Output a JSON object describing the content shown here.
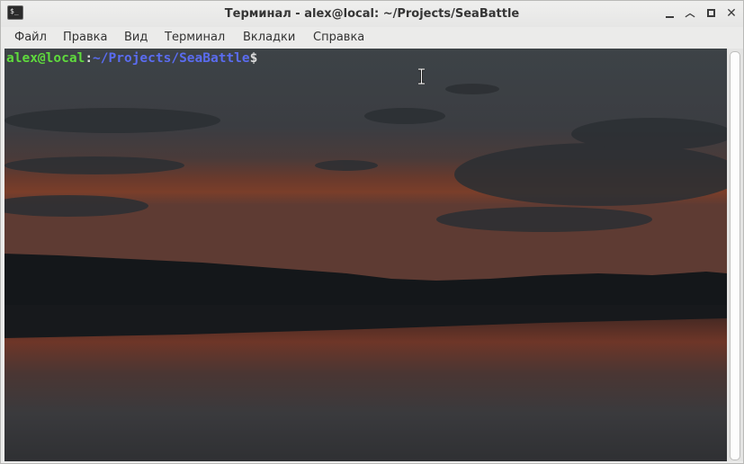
{
  "window": {
    "title": "Терминал - alex@local: ~/Projects/SeaBattle",
    "app_icon_glyph": "$_",
    "controls": {
      "minimize_icon": "minimize-icon",
      "chevron_icon": "chevron-up-icon",
      "chevron_glyph": "︿",
      "maximize_icon": "maximize-icon",
      "close_icon": "close-icon",
      "close_glyph": "✕"
    }
  },
  "menu": {
    "items": [
      "Файл",
      "Правка",
      "Вид",
      "Терминал",
      "Вкладки",
      "Справка"
    ]
  },
  "terminal": {
    "prompt": {
      "user_host": "alex@local",
      "colon": ":",
      "path": "~/Projects/SeaBattle",
      "symbol": "$"
    },
    "colors": {
      "user_host": "#5fdb3d",
      "path": "#5a6cf0",
      "text": "#dcdcdc"
    }
  }
}
